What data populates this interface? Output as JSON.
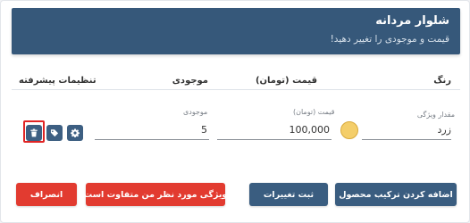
{
  "header": {
    "title": "شلوار مردانه",
    "subtitle": "قیمت و موجودی را تغییر دهید!"
  },
  "columns": {
    "color": "رنگ",
    "price": "قیمت (تومان)",
    "stock": "موجودی",
    "advanced": "تنظیمات پیشرفته"
  },
  "row": {
    "attribute_label": "مقدار ویژگی",
    "attribute_value": "زرد",
    "price_label": "قیمت (تومان)",
    "price_value": "100,000",
    "stock_label": "موجودی",
    "stock_value": "5",
    "swatch_color": "#f4ce6a"
  },
  "actions": {
    "settings_icon": "gear-icon",
    "tag_icon": "tag-icon",
    "delete_icon": "trash-icon"
  },
  "buttons": {
    "add_combination": "اضافه کردن ترکیب محصول",
    "save_changes": "ثبت تغییرات",
    "attribute_not_found": "ویژگی مورد نظر من متفاوت است",
    "cancel": "انصراف"
  },
  "colors": {
    "header_bg": "#36587a",
    "button_navy": "#3a5d80",
    "button_red": "#e23b30"
  }
}
